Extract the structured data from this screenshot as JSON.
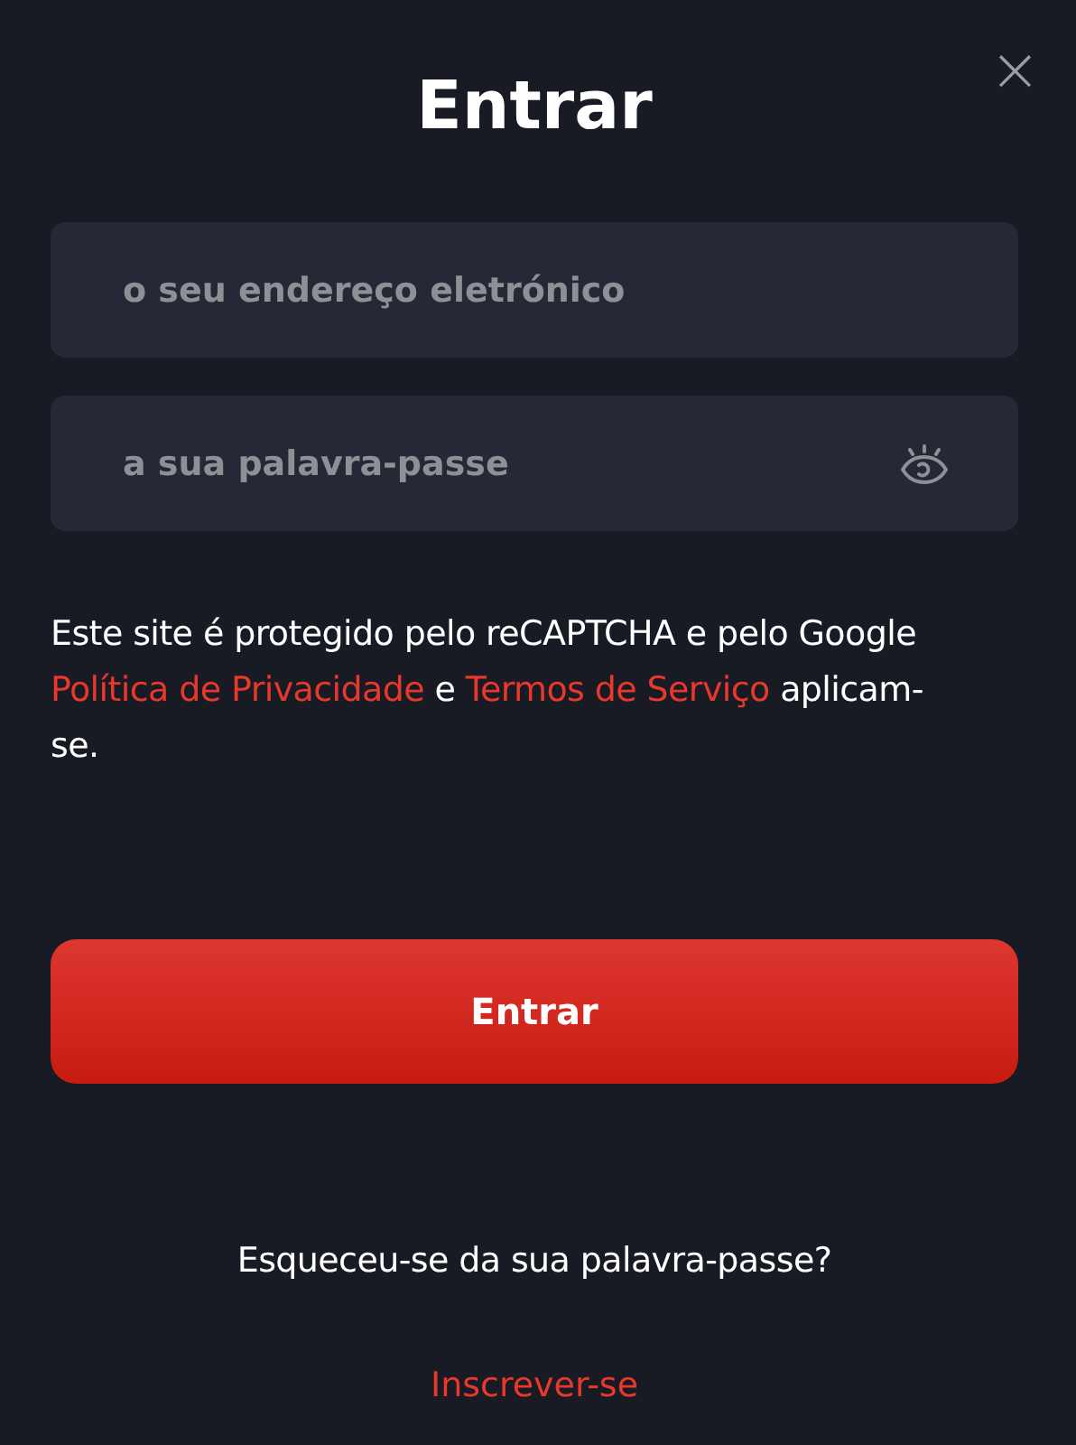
{
  "dialog": {
    "title": "Entrar",
    "close": "×"
  },
  "fields": [
    {
      "kind": "email",
      "placeholder": "o seu endereço eletrónico"
    },
    {
      "kind": "password",
      "placeholder": "a sua palavra-passe"
    }
  ],
  "notice": [
    {
      "kind": "plain",
      "text": "Este site é protegido pelo reCAPTCHA e pelo Google "
    },
    {
      "kind": "link",
      "text": "Política de Privacidade"
    },
    {
      "kind": "plain",
      "text": " e "
    },
    {
      "kind": "link",
      "text": "Termos de Serviço"
    },
    {
      "kind": "plain",
      "text": " aplicam-se."
    }
  ],
  "submit": "Entrar",
  "forgot_password": "Esqueceu-se da sua palavra-passe?",
  "sign_up": "Inscrever-se"
}
